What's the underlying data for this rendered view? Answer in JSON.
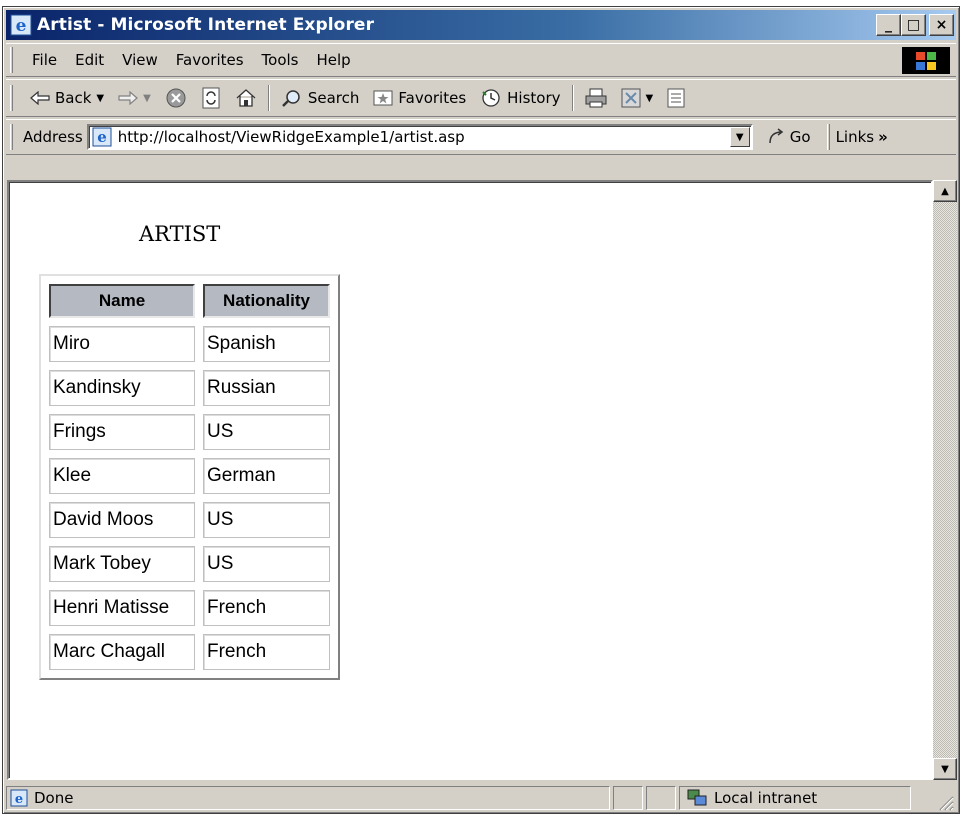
{
  "window": {
    "title": "Artist - Microsoft Internet Explorer",
    "minimize": "_",
    "maximize": "□",
    "close": "×"
  },
  "menu": [
    "File",
    "Edit",
    "View",
    "Favorites",
    "Tools",
    "Help"
  ],
  "toolbar": {
    "back": "Back",
    "search": "Search",
    "favorites": "Favorites",
    "history": "History"
  },
  "address": {
    "label": "Address",
    "url": "http://localhost/ViewRidgeExample1/artist.asp",
    "go": "Go",
    "links": "Links",
    "links_chevron": "»"
  },
  "page": {
    "heading": "ARTIST",
    "columns": [
      "Name",
      "Nationality"
    ],
    "rows": [
      [
        "Miro",
        "Spanish"
      ],
      [
        "Kandinsky",
        "Russian"
      ],
      [
        "Frings",
        "US"
      ],
      [
        "Klee",
        "German"
      ],
      [
        "David Moos",
        "US"
      ],
      [
        "Mark Tobey",
        "US"
      ],
      [
        "Henri Matisse",
        "French"
      ],
      [
        "Marc Chagall",
        "French"
      ]
    ]
  },
  "status": {
    "text": "Done",
    "zone": "Local intranet"
  },
  "icons": {
    "ie_logo": "ie-logo-icon",
    "windows_flag": "windows-flag-icon",
    "stop": "stop-icon",
    "refresh": "refresh-icon",
    "home": "home-icon",
    "print": "printer-icon",
    "edit": "edit-icon",
    "discuss": "discuss-icon"
  },
  "colors": {
    "titlebar_start": "#0a246a",
    "titlebar_end": "#a6caf0",
    "chrome": "#d4d0c8",
    "header_cell": "#b4b9c2"
  }
}
